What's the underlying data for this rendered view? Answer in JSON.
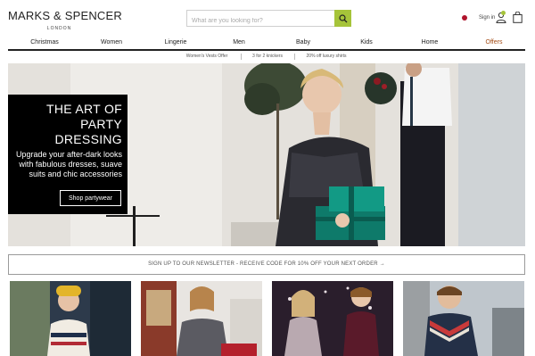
{
  "header": {
    "logo_main": "MARKS & SPENCER",
    "logo_sub": "LONDON",
    "search_placeholder": "What are you looking for?",
    "signin_label": "Sign in",
    "accent_color": "#a6c43a"
  },
  "nav": {
    "items": [
      "Christmas",
      "Women",
      "Lingerie",
      "Men",
      "Baby",
      "Kids",
      "Home",
      "Offers"
    ],
    "offers_color": "#a34b14"
  },
  "promo": {
    "items": [
      "Women's Vests Offer",
      "3 for 2 knickers",
      "20% off luxury shirts"
    ]
  },
  "hero": {
    "title_line1": "THE ART OF",
    "title_line2": "PARTY DRESSING",
    "body": "Upgrade your after-dark looks with fabulous dresses, suave suits and chic accessories",
    "button_label": "Shop partywear"
  },
  "newsletter": {
    "text": "SIGN UP TO OUR NEWSLETTER - RECEIVE CODE FOR 10% OFF YOUR NEXT ORDER →"
  },
  "tiles": [
    {
      "name": "tile-womens-knitwear"
    },
    {
      "name": "tile-womens-sweatshirt"
    },
    {
      "name": "tile-kids-partywear"
    },
    {
      "name": "tile-mens-knitwear"
    }
  ]
}
